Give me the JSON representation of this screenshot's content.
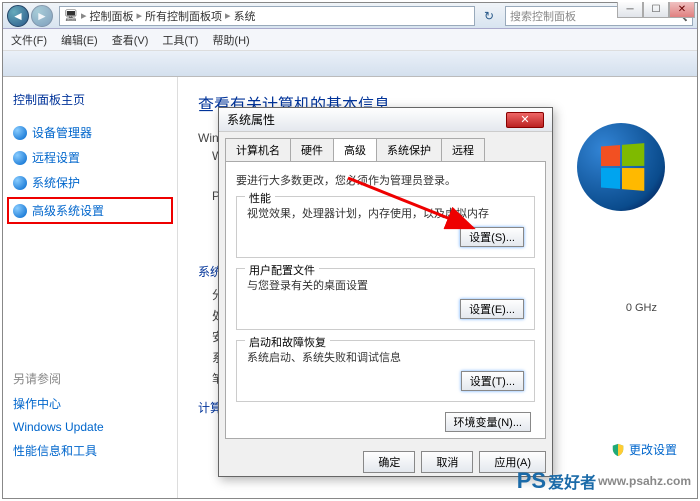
{
  "breadcrumb": {
    "a": "控制面板",
    "b": "所有控制面板项",
    "c": "系统"
  },
  "search": {
    "placeholder": "搜索控制面板"
  },
  "menu": {
    "file": "文件(F)",
    "edit": "编辑(E)",
    "view": "查看(V)",
    "tools": "工具(T)",
    "help": "帮助(H)"
  },
  "sidebar": {
    "home": "控制面板主页",
    "items": [
      "设备管理器",
      "远程设置",
      "系统保护",
      "高级系统设置"
    ],
    "seealso": "另请参阅",
    "foot": [
      "操作中心",
      "Windows Update",
      "性能信息和工具"
    ]
  },
  "main": {
    "title": "查看有关计算机的基本信息",
    "winedit": "Wind",
    "w2": "W",
    "pe": "Pe",
    "system": "系统",
    "rows": [
      "分",
      "处",
      "安",
      "系",
      "笔"
    ],
    "comp": "计算",
    "ghz": "0 GHz",
    "change": "更改设置"
  },
  "dialog": {
    "title": "系统属性",
    "tabs": [
      "计算机名",
      "硬件",
      "高级",
      "系统保护",
      "远程"
    ],
    "adminnote": "要进行大多数更改，您必须作为管理员登录。",
    "perf": {
      "title": "性能",
      "desc": "视觉效果，处理器计划，内存使用，以及虚拟内存",
      "btn": "设置(S)..."
    },
    "profile": {
      "title": "用户配置文件",
      "desc": "与您登录有关的桌面设置",
      "btn": "设置(E)..."
    },
    "recovery": {
      "title": "启动和故障恢复",
      "desc": "系统启动、系统失败和调试信息",
      "btn": "设置(T)..."
    },
    "env": "环境变量(N)...",
    "ok": "确定",
    "cancel": "取消",
    "apply": "应用(A)"
  },
  "watermark": {
    "ps": "PS",
    "txt": "爱好者",
    "url": "www.psahz.com"
  }
}
